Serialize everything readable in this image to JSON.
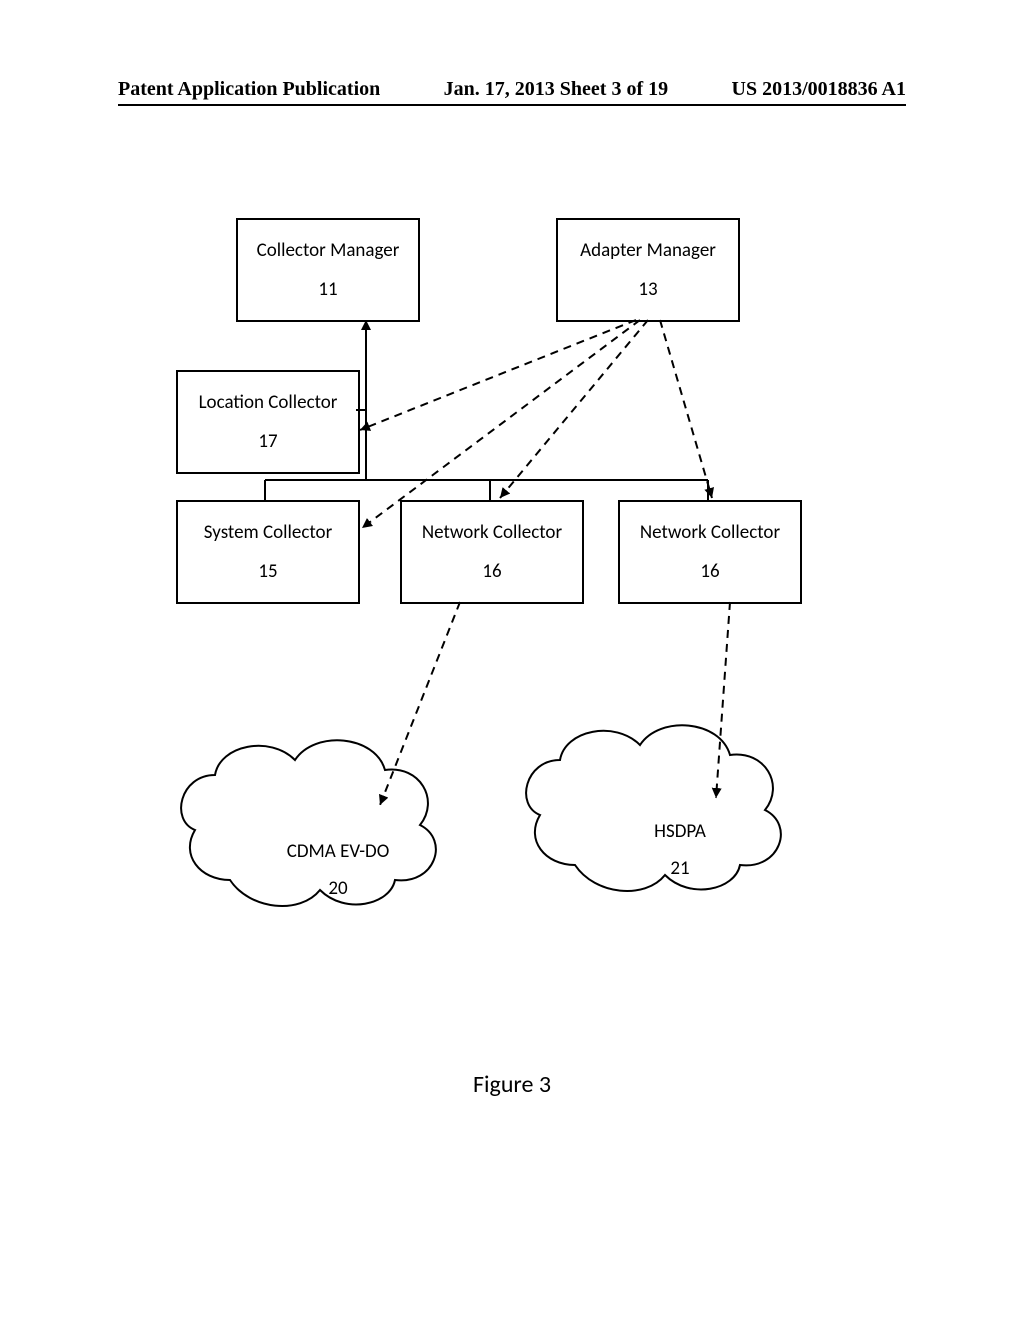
{
  "header": {
    "left": "Patent Application Publication",
    "mid": "Jan. 17, 2013  Sheet 3 of 19",
    "right": "US 2013/0018836 A1"
  },
  "boxes": {
    "collector_manager": {
      "title": "Collector Manager",
      "num": "11"
    },
    "adapter_manager": {
      "title": "Adapter Manager",
      "num": "13"
    },
    "location_collector": {
      "title": "Location Collector",
      "num": "17"
    },
    "system_collector": {
      "title": "System Collector",
      "num": "15"
    },
    "network_collector_a": {
      "title": "Network Collector",
      "num": "16"
    },
    "network_collector_b": {
      "title": "Network Collector",
      "num": "16"
    }
  },
  "clouds": {
    "cdma": {
      "title": "CDMA EV-DO",
      "num": "20"
    },
    "hsdpa": {
      "title": "HSDPA",
      "num": "21"
    }
  },
  "caption": "Figure 3"
}
